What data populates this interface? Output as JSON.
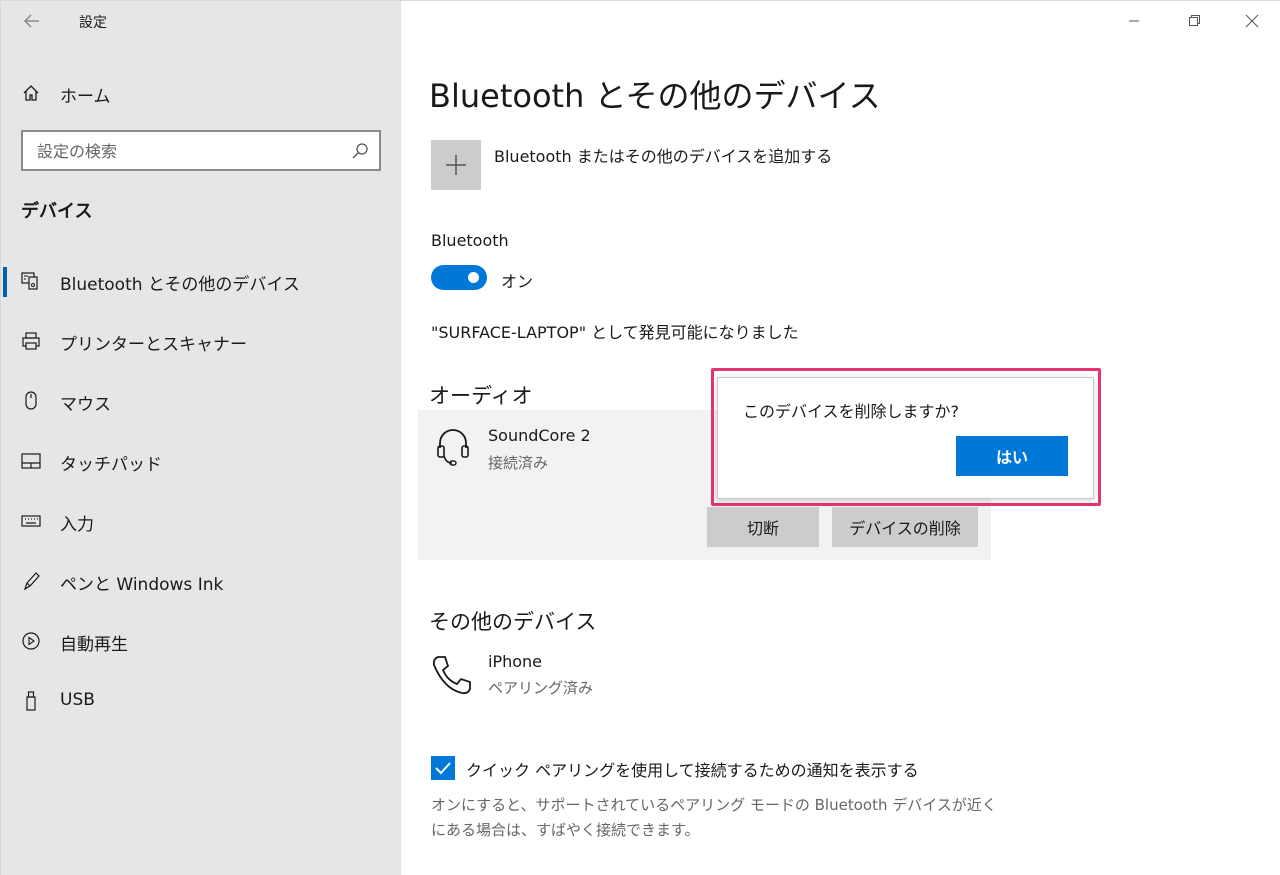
{
  "window": {
    "app_title": "設定"
  },
  "sidebar": {
    "home_label": "ホーム",
    "search_placeholder": "設定の検索",
    "section_title": "デバイス",
    "items": [
      {
        "label": "Bluetooth とその他のデバイス",
        "icon": "bluetooth-devices-icon",
        "active": true
      },
      {
        "label": "プリンターとスキャナー",
        "icon": "printer-icon"
      },
      {
        "label": "マウス",
        "icon": "mouse-icon"
      },
      {
        "label": "タッチパッド",
        "icon": "touchpad-icon"
      },
      {
        "label": "入力",
        "icon": "keyboard-icon"
      },
      {
        "label": "ペンと Windows Ink",
        "icon": "pen-icon"
      },
      {
        "label": "自動再生",
        "icon": "autoplay-icon"
      },
      {
        "label": "USB",
        "icon": "usb-icon"
      }
    ]
  },
  "main": {
    "title": "Bluetooth とその他のデバイス",
    "add_label": "Bluetooth またはその他のデバイスを追加する",
    "bluetooth_label": "Bluetooth",
    "toggle_state": "オン",
    "discoverable_text": "\"SURFACE-LAPTOP\" として発見可能になりました",
    "audio_title": "オーディオ",
    "audio_device": {
      "name": "SoundCore 2",
      "status": "接続済み",
      "icon": "headset-icon",
      "disconnect_label": "切断",
      "remove_label": "デバイスの削除"
    },
    "other_title": "その他のデバイス",
    "other_device": {
      "name": "iPhone",
      "status": "ペアリング済み",
      "icon": "phone-icon"
    },
    "quick_pair_label": "クイック ペアリングを使用して接続するための通知を表示する",
    "quick_pair_checked": true,
    "help_text": "オンにすると、サポートされているペアリング モードの Bluetooth デバイスが近くにある場合は、すばやく接続できます。"
  },
  "dialog": {
    "message": "このデバイスを削除しますか?",
    "yes_label": "はい"
  },
  "colors": {
    "accent": "#0078d7",
    "highlight": "#e8336c",
    "sidebar_bg": "#e6e6e6"
  }
}
